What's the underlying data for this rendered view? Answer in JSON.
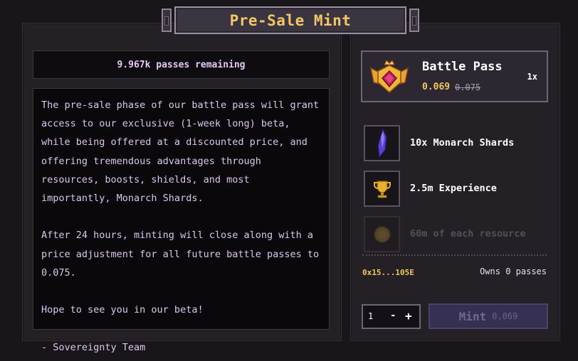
{
  "header": {
    "title": "Pre-Sale Mint"
  },
  "supply": {
    "remaining_text": "9.967k passes remaining"
  },
  "description": {
    "paragraphs": [
      "The pre-sale phase of our battle pass will grant access to our exclusive (1-week long) beta, while being offered at a discounted price, and offering tremendous advantages through resources, boosts, shields, and most importantly, Monarch Shards.",
      "After 24 hours, minting will close along with a price adjustment for all future battle passes to 0.075.",
      "Hope to see you in our beta!",
      "- Sovereignty Team"
    ]
  },
  "product": {
    "name": "Battle Pass",
    "price": "0.069",
    "old_price": "0.075",
    "quantity_label": "1x",
    "icon": "crown-shield-badge-icon"
  },
  "rewards": [
    {
      "label": "10x Monarch Shards",
      "icon": "purple-crystal-icon"
    },
    {
      "label": "2.5m Experience",
      "icon": "trophy-icon"
    },
    {
      "label": "60m of each resource",
      "icon": "coin-icon"
    }
  ],
  "wallet": {
    "address": "0x15...105E",
    "owns_text": "Owns 0 passes"
  },
  "order": {
    "quantity": "1",
    "minus_label": "-",
    "plus_label": "+",
    "mint_label": "Mint",
    "mint_price": "0.069"
  },
  "colors": {
    "accent_gold": "#f3c766",
    "text_lavender": "#e7c8f7",
    "mint_button": "#363052",
    "background": "#19161a"
  }
}
